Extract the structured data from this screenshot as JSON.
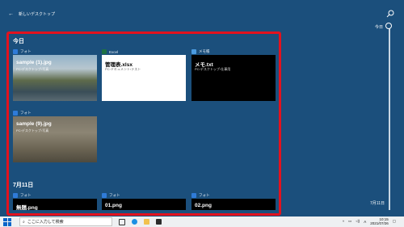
{
  "header": {
    "back_label": "新しいデスクトップ"
  },
  "timeline": {
    "top_label": "今日",
    "bottom_label": "7月11日"
  },
  "sections": [
    {
      "title": "今日",
      "cards": [
        {
          "app": "フォト",
          "title": "sample (1).jpg",
          "subtitle": "PC›デスクトップ›写真"
        },
        {
          "app": "Excel",
          "title": "管理表.xlsx",
          "subtitle": "PC›ドキュメント›テスト"
        },
        {
          "app": "メモ帳",
          "title": "メモ.txt",
          "subtitle": "PC›デスクトップ›仕事用"
        },
        {
          "app": "フォト",
          "title": "sample (9).jpg",
          "subtitle": "PC›デスクトップ›写真"
        }
      ]
    },
    {
      "title": "7月11日",
      "cards": [
        {
          "app": "フォト",
          "title": "無題.png"
        },
        {
          "app": "フォト",
          "title": "01.png"
        },
        {
          "app": "フォト",
          "title": "02.png"
        }
      ]
    }
  ],
  "taskbar": {
    "search_placeholder": "ここに入力して検索",
    "ime": "A",
    "time": "10:15",
    "date": "2021/07/26"
  },
  "colors": {
    "background": "#1b4f7c",
    "highlight": "#e3121e",
    "excel": "#1e7145",
    "photos": "#2f7bd8",
    "notepad": "#4a9be0"
  }
}
